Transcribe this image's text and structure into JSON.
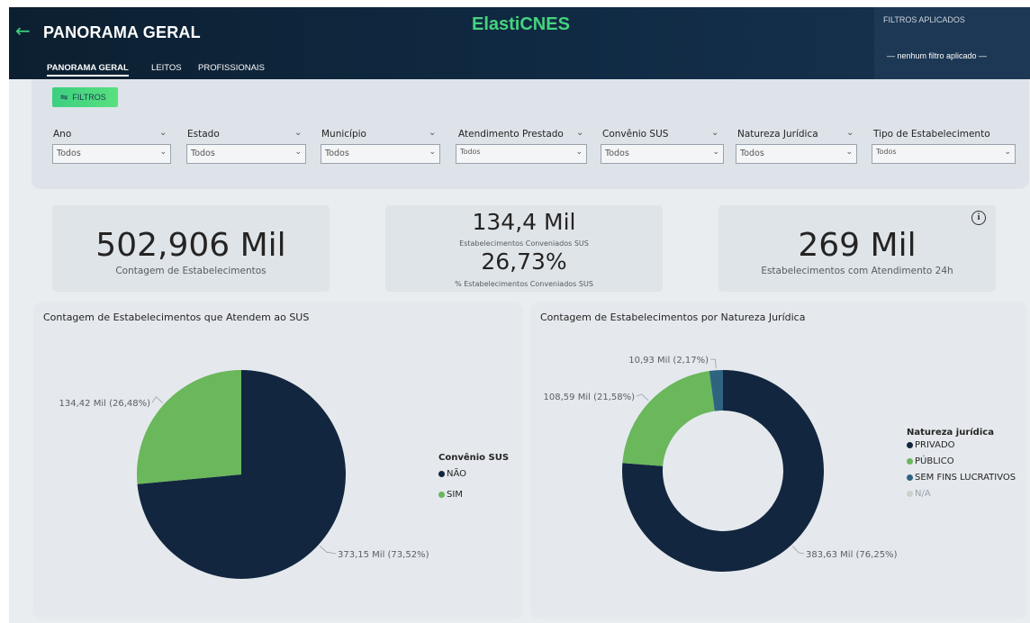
{
  "header": {
    "back_icon": "arrow-left-icon",
    "title": "PANORAMA GERAL",
    "brand_prefix": "Elasti",
    "brand_suffix": "CNES",
    "tabs": [
      "PANORAMA GERAL",
      "LEITOS",
      "PROFISSIONAIS"
    ],
    "applied_filters_title": "FILTROS APLICADOS",
    "applied_filters_value": "— nenhum filtro aplicado —"
  },
  "filters": {
    "button_label": "FILTROS",
    "button_icon": "sliders-icon",
    "fields": [
      {
        "label": "Ano",
        "value": "Todos"
      },
      {
        "label": "Estado",
        "value": "Todos"
      },
      {
        "label": "Município",
        "value": "Todos"
      },
      {
        "label": "Atendimento Prestado",
        "value": "Todos"
      },
      {
        "label": "Convênio SUS",
        "value": "Todos"
      },
      {
        "label": "Natureza Jurídica",
        "value": "Todos"
      },
      {
        "label": "Tipo de Estabelecimento",
        "value": "Todos"
      }
    ]
  },
  "kpis": {
    "total": {
      "value": "502,906 Mil",
      "label": "Contagem de Estabelecimentos"
    },
    "sus": {
      "value": "134,4 Mil",
      "label": "Estabelecimentos Conveniados SUS",
      "percent": "26,73%",
      "percent_label": "% Estabelecimentos Conveniados SUS"
    },
    "atend24h": {
      "value": "269 Mil",
      "label": "Estabelecimentos com Atendimento 24h",
      "info_icon": "info-icon"
    }
  },
  "colors": {
    "dark_navy": "#12263f",
    "green": "#6ab75c",
    "teal": "#2e6480",
    "light_gray": "#c9d3cc",
    "accent_green": "#46d37f"
  },
  "chart_data": [
    {
      "type": "pie",
      "title": "Contagem de Estabelecimentos que Atendem ao SUS",
      "legend_title": "Convênio SUS",
      "legend_position": "right",
      "slices": [
        {
          "name": "NÃO",
          "value": 373.15,
          "percent": 73.52,
          "label": "373,15 Mil (73,52%)",
          "color": "#12263f"
        },
        {
          "name": "SIM",
          "value": 134.42,
          "percent": 26.48,
          "label": "134,42 Mil (26,48%)",
          "color": "#6ab75c"
        }
      ]
    },
    {
      "type": "pie",
      "subtype": "donut",
      "title": "Contagem de Estabelecimentos por Natureza Jurídica",
      "legend_title": "Natureza jurídica",
      "legend_position": "right",
      "slices": [
        {
          "name": "PRIVADO",
          "value": 383.63,
          "percent": 76.25,
          "label": "383,63 Mil (76,25%)",
          "color": "#12263f"
        },
        {
          "name": "PÚBLICO",
          "value": 108.59,
          "percent": 21.58,
          "label": "108,59 Mil (21,58%)",
          "color": "#6ab75c"
        },
        {
          "name": "SEM FINS LUCRATIVOS",
          "value": 10.93,
          "percent": 2.17,
          "label": "10,93 Mil (2,17%)",
          "color": "#2e6480"
        },
        {
          "name": "N/A",
          "value": 0,
          "percent": 0,
          "label": "",
          "color": "#c9d3cc"
        }
      ]
    }
  ]
}
